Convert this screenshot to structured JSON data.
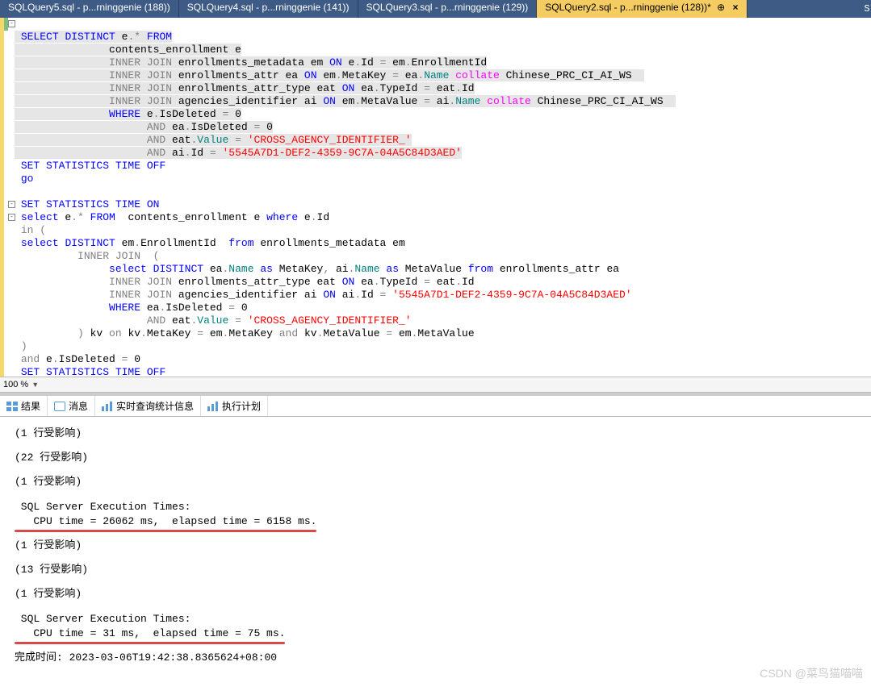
{
  "tabs": [
    {
      "label": "SQLQuery5.sql - p...rninggenie (188))"
    },
    {
      "label": "SQLQuery4.sql - p...rninggenie (141))"
    },
    {
      "label": "SQLQuery3.sql - p...rninggenie (129))"
    },
    {
      "label": "SQLQuery2.sql - p...rninggenie (128))*"
    }
  ],
  "rightcut": "S",
  "code": {
    "l1a": "SELECT",
    "l1b": "DISTINCT",
    "l1c": " e",
    "l1d": ".*",
    "l1e": "FROM",
    "l2": "contents_enrollment e",
    "l3a": "INNER",
    "l3b": "JOIN",
    "l3c": " enrollments_metadata em ",
    "l3d": "ON",
    "l3e": " e",
    "l3f": ".",
    "l3g": "Id ",
    "l3h": "=",
    "l3i": " em",
    "l3j": ".",
    "l3k": "EnrollmentId",
    "l4a": "INNER",
    "l4b": "JOIN",
    "l4c": " enrollments_attr ea ",
    "l4d": "ON",
    "l4e": " em",
    "l4f": ".",
    "l4g": "MetaKey ",
    "l4h": "=",
    "l4i": " ea",
    "l4j": ".",
    "l4k": "Name ",
    "l4l": "collate",
    "l4m": " Chinese_PRC_CI_AI_WS",
    "l5a": "INNER",
    "l5b": "JOIN",
    "l5c": " enrollments_attr_type eat ",
    "l5d": "ON",
    "l5e": " ea",
    "l5f": ".",
    "l5g": "TypeId ",
    "l5h": "=",
    "l5i": " eat",
    "l5j": ".",
    "l5k": "Id",
    "l6a": "INNER",
    "l6b": "JOIN",
    "l6c": " agencies_identifier ai ",
    "l6d": "ON",
    "l6e": " em",
    "l6f": ".",
    "l6g": "MetaValue ",
    "l6h": "=",
    "l6i": " ai",
    "l6j": ".",
    "l6k": "Name ",
    "l6l": "collate",
    "l6m": " Chinese_PRC_CI_AI_WS",
    "l7a": "WHERE",
    "l7b": " e",
    "l7c": ".",
    "l7d": "IsDeleted ",
    "l7e": "=",
    "l7f": " 0",
    "l8a": "AND",
    "l8b": " ea",
    "l8c": ".",
    "l8d": "IsDeleted ",
    "l8e": "=",
    "l8f": " 0",
    "l9a": "AND",
    "l9b": " eat",
    "l9c": ".",
    "l9d": "Value",
    "l9e": " =",
    "l9f": " 'CROSS_AGENCY_IDENTIFIER_'",
    "l10a": "AND",
    "l10b": " ai",
    "l10c": ".",
    "l10d": "Id ",
    "l10e": "=",
    "l10f": " '5545A7D1-DEF2-4359-9C7A-04A5C84D3AED'",
    "l11": "SET STATISTICS TIME OFF",
    "l12": "go",
    "l14": "SET STATISTICS TIME ON",
    "l15a": "select",
    "l15b": " e",
    "l15c": ".*",
    "l15d": "FROM",
    "l15e": "  contents_enrollment e ",
    "l15f": "where",
    "l15g": " e",
    "l15h": ".",
    "l15i": "Id",
    "l16a": "in",
    "l16b": " (",
    "l17a": "select",
    "l17b": "DISTINCT",
    "l17c": " em",
    "l17d": ".",
    "l17e": "EnrollmentId  ",
    "l17f": "from",
    "l17g": " enrollments_metadata em",
    "l18a": "INNER",
    "l18b": "JOIN",
    "l18c": "  (",
    "l19a": "select",
    "l19b": "DISTINCT",
    "l19c": " ea",
    "l19d": ".",
    "l19e": "Name ",
    "l19f": "as",
    "l19g": " MetaKey",
    "l19h": ",",
    "l19i": " ai",
    "l19j": ".",
    "l19k": "Name ",
    "l19l": "as",
    "l19m": " MetaValue ",
    "l19n": "from",
    "l19o": " enrollments_attr ea",
    "l20a": "INNER",
    "l20b": "JOIN",
    "l20c": " enrollments_attr_type eat ",
    "l20d": "ON",
    "l20e": " ea",
    "l20f": ".",
    "l20g": "TypeId ",
    "l20h": "=",
    "l20i": " eat",
    "l20j": ".",
    "l20k": "Id",
    "l21a": "INNER",
    "l21b": "JOIN",
    "l21c": " agencies_identifier ai ",
    "l21d": "ON",
    "l21e": " ai",
    "l21f": ".",
    "l21g": "Id ",
    "l21h": "=",
    "l21i": " '5545A7D1-DEF2-4359-9C7A-04A5C84D3AED'",
    "l22a": "WHERE",
    "l22b": " ea",
    "l22c": ".",
    "l22d": "IsDeleted ",
    "l22e": "=",
    "l22f": " 0",
    "l23a": "AND",
    "l23b": " eat",
    "l23c": ".",
    "l23d": "Value",
    "l23e": " =",
    "l23f": " 'CROSS_AGENCY_IDENTIFIER_'",
    "l24a": ")",
    "l24b": " kv ",
    "l24c": "on",
    "l24d": " kv",
    "l24e": ".",
    "l24f": "MetaKey ",
    "l24g": "=",
    "l24h": " em",
    "l24i": ".",
    "l24j": "MetaKey ",
    "l24k": "and",
    "l24l": " kv",
    "l24m": ".",
    "l24n": "MetaValue ",
    "l24o": "=",
    "l24p": " em",
    "l24q": ".",
    "l24r": "MetaValue",
    "l25": ")",
    "l26a": "and",
    "l26b": " e",
    "l26c": ".",
    "l26d": "IsDeleted ",
    "l26e": "=",
    "l26f": " 0",
    "l27": "SET STATISTICS TIME OFF"
  },
  "zoom": "100 %",
  "result_tabs": {
    "r1": "结果",
    "r2": "消息",
    "r3": "实时查询统计信息",
    "r4": "执行计划"
  },
  "messages": {
    "m1": "(1 行受影响)",
    "m2": "(22 行受影响)",
    "m3": "(1 行受影响)",
    "m4a": " SQL Server Execution Times:",
    "m4b": "   CPU time = 26062 ms,  elapsed time = 6158 ms.",
    "m5": "(1 行受影响)",
    "m6": "(13 行受影响)",
    "m7": "(1 行受影响)",
    "m8a": " SQL Server Execution Times:",
    "m8b": "   CPU time = 31 ms,  elapsed time = 75 ms.",
    "m9": "完成时间: 2023-03-06T19:42:38.8365624+08:00"
  },
  "watermark": "CSDN @菜鸟猫喵喵",
  "close_x": "×",
  "pin": "⊕"
}
